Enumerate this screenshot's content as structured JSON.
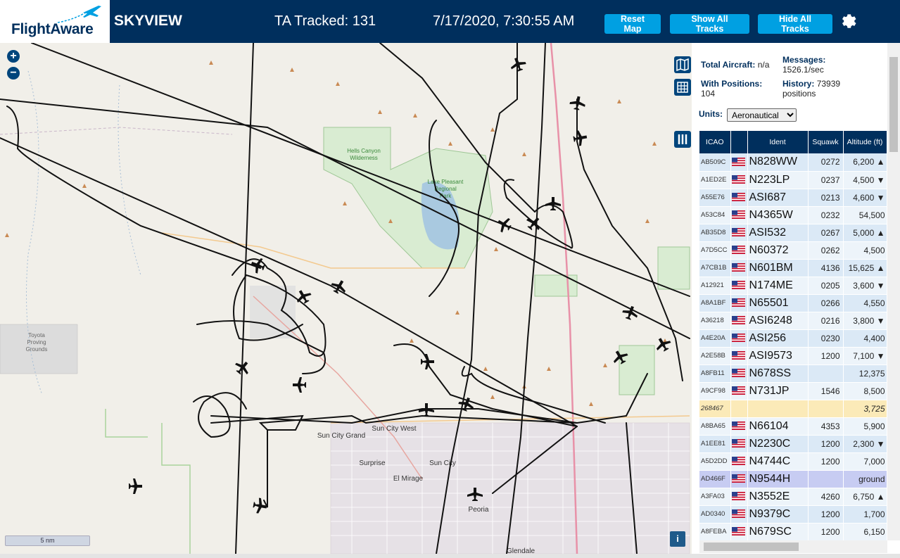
{
  "header": {
    "logo_text": "FlightAware",
    "site_title": "SKYVIEW",
    "tracked": "TA Tracked: 131",
    "clock": "7/17/2020, 7:30:55 AM",
    "buttons": {
      "reset": "Reset Map",
      "show_all": "Show All Tracks",
      "hide_all": "Hide All Tracks"
    }
  },
  "map": {
    "zoom_in": "+",
    "zoom_out": "−",
    "scale": "5 nm",
    "info": "i",
    "labels": [
      "Hells Canyon\nWilderness",
      "Lake Pleasant\nRegional\nPark",
      "Toyota\nProving\nGrounds",
      "Sun City Grand",
      "Sun City West",
      "Surprise",
      "Sun City",
      "El Mirage",
      "Peoria",
      "Glendale"
    ]
  },
  "sidebar": {
    "total_label": "Total Aircraft:",
    "total_value": "n/a",
    "positions_label": "With Positions:",
    "positions_value": "104",
    "messages_label": "Messages:",
    "messages_value": "1526.1/sec",
    "history_label": "History:",
    "history_value": "73939",
    "history_unit": "positions",
    "units_label": "Units:",
    "units_value": "Aeronautical"
  },
  "table": {
    "headers": [
      "ICAO",
      "",
      "Ident",
      "Squawk",
      "Altitude (ft)"
    ],
    "rows": [
      {
        "icao": "AB509C",
        "ident": "N828WW",
        "squawk": "0272",
        "alt": "6,200 ▲"
      },
      {
        "icao": "A1ED2E",
        "ident": "N223LP",
        "squawk": "0237",
        "alt": "4,500 ▼"
      },
      {
        "icao": "A55E76",
        "ident": "ASI687",
        "squawk": "0213",
        "alt": "4,600 ▼"
      },
      {
        "icao": "A53C84",
        "ident": "N4365W",
        "squawk": "0232",
        "alt": "54,500"
      },
      {
        "icao": "AB35D8",
        "ident": "ASI532",
        "squawk": "0267",
        "alt": "5,000 ▲"
      },
      {
        "icao": "A7D5CC",
        "ident": "N60372",
        "squawk": "0262",
        "alt": "4,500"
      },
      {
        "icao": "A7CB1B",
        "ident": "N601BM",
        "squawk": "4136",
        "alt": "15,625 ▲"
      },
      {
        "icao": "A12921",
        "ident": "N174ME",
        "squawk": "0205",
        "alt": "3,600 ▼"
      },
      {
        "icao": "A8A1BF",
        "ident": "N65501",
        "squawk": "0266",
        "alt": "4,550"
      },
      {
        "icao": "A36218",
        "ident": "ASI6248",
        "squawk": "0216",
        "alt": "3,800 ▼"
      },
      {
        "icao": "A4E20A",
        "ident": "ASI256",
        "squawk": "0230",
        "alt": "4,400"
      },
      {
        "icao": "A2E58B",
        "ident": "ASI9573",
        "squawk": "1200",
        "alt": "7,100 ▼"
      },
      {
        "icao": "A8FB11",
        "ident": "N678SS",
        "squawk": "",
        "alt": "12,375"
      },
      {
        "icao": "A9CF98",
        "ident": "N731JP",
        "squawk": "1546",
        "alt": "8,500"
      },
      {
        "icao": "268467",
        "ident": "",
        "squawk": "",
        "alt": "3,725",
        "warn": true
      },
      {
        "icao": "A8BA65",
        "ident": "N66104",
        "squawk": "4353",
        "alt": "5,900"
      },
      {
        "icao": "A1EE81",
        "ident": "N2230C",
        "squawk": "1200",
        "alt": "2,300 ▼"
      },
      {
        "icao": "A5D2DD",
        "ident": "N4744C",
        "squawk": "1200",
        "alt": "7,000"
      },
      {
        "icao": "AD466F",
        "ident": "N9544H",
        "squawk": "",
        "alt": "ground",
        "sel": true
      },
      {
        "icao": "A3FA03",
        "ident": "N3552E",
        "squawk": "4260",
        "alt": "6,750 ▲"
      },
      {
        "icao": "AD0340",
        "ident": "N9379C",
        "squawk": "1200",
        "alt": "1,700"
      },
      {
        "icao": "A8FEBA",
        "ident": "N679SC",
        "squawk": "1200",
        "alt": "6,150"
      }
    ]
  },
  "colors": {
    "header_bg": "#002f5d",
    "button_bg": "#00a0e2",
    "row_even": "#dbe9f6",
    "row_odd": "#edf4fa",
    "row_warn": "#fbeab8",
    "row_selected": "#c7ccf2"
  }
}
